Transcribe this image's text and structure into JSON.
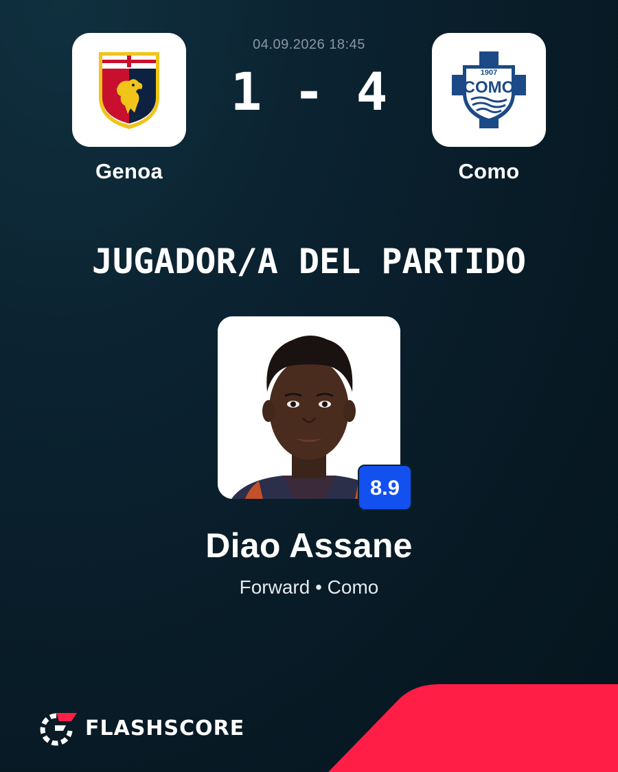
{
  "match": {
    "datetime": "04.09.2026 18:45",
    "score": "1 - 4",
    "home": {
      "name": "Genoa",
      "crest_icon": "genoa-crest-icon"
    },
    "away": {
      "name": "Como",
      "crest_icon": "como-crest-icon",
      "crest_text_year": "1907",
      "crest_text_name": "COMO"
    }
  },
  "award": {
    "headline": "JUGADOR/A DEL PARTIDO"
  },
  "player": {
    "name": "Diao Assane",
    "meta": "Forward • Como",
    "rating": "8.9",
    "photo_icon": "player-photo"
  },
  "brand": {
    "name": "FLASHSCORE",
    "logo_icon": "flashscore-logo-icon"
  },
  "colors": {
    "background": "#0b2230",
    "accent_red": "#ff1e46",
    "rating_blue": "#1350f0",
    "genoa_red": "#c8102e",
    "genoa_navy": "#0d2240",
    "como_blue": "#1b4a86"
  }
}
